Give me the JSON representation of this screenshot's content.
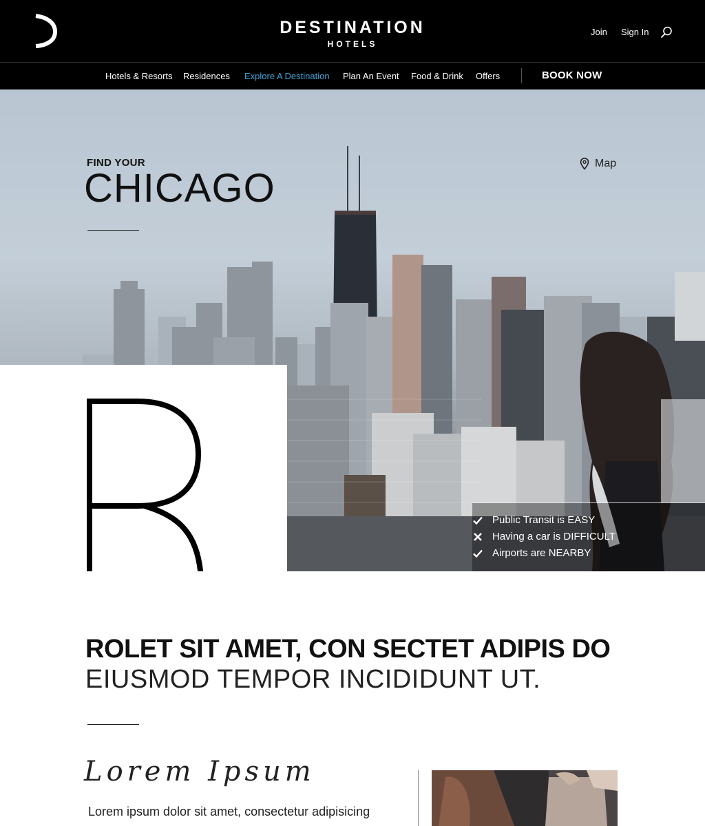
{
  "header": {
    "brand_main": "DESTINATION",
    "brand_sub": "HOTELS",
    "join_label": "Join",
    "signin_label": "Sign In",
    "search_icon": "search-icon",
    "logo_icon": "destination-logo-mark"
  },
  "nav": {
    "items": [
      {
        "label": "Hotels & Resorts"
      },
      {
        "label": "Residences"
      },
      {
        "label": "Explore A Destination",
        "active": true
      },
      {
        "label": "Plan An Event"
      },
      {
        "label": "Food & Drink"
      },
      {
        "label": "Offers"
      }
    ],
    "book_label": "BOOK NOW",
    "active_color": "#3fa3d4"
  },
  "hero": {
    "kicker": "FIND YOUR",
    "city": "CHICAGO",
    "map_label": "Map",
    "map_icon": "map-pin-icon",
    "big_letter": "R",
    "features": [
      {
        "icon": "check-icon",
        "text": "Public Transit is EASY"
      },
      {
        "icon": "x-icon",
        "text": "Having a car is DIFFICULT"
      },
      {
        "icon": "check-icon",
        "text": "Airports are NEARBY"
      }
    ]
  },
  "content": {
    "headline_bold": "ROLET SIT AMET, CON SECTET ADIPIS DO",
    "headline_light": "EIUSMOD TEMPOR INCIDIDUNT UT.",
    "script_title": "Lorem Ipsum",
    "body": "Lorem ipsum dolor sit amet, consectetur adipisicing"
  }
}
